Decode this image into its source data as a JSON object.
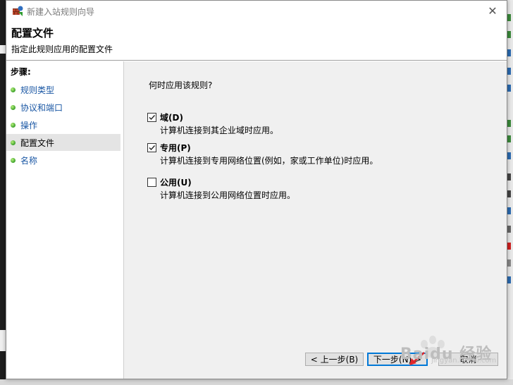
{
  "window": {
    "title": "新建入站规则向导",
    "close_glyph": "✕"
  },
  "header": {
    "title": "配置文件",
    "subtitle": "指定此规则应用的配置文件"
  },
  "steps": {
    "title": "步骤:",
    "items": [
      {
        "label": "规则类型"
      },
      {
        "label": "协议和端口"
      },
      {
        "label": "操作"
      },
      {
        "label": "配置文件",
        "active": true
      },
      {
        "label": "名称"
      }
    ]
  },
  "main": {
    "question": "何时应用该规则?",
    "options": [
      {
        "label": "域(D)",
        "description": "计算机连接到其企业域时应用。",
        "checked": true
      },
      {
        "label": "专用(P)",
        "description": "计算机连接到专用网络位置(例如，家或工作单位)时应用。",
        "checked": true
      },
      {
        "label": "公用(U)",
        "description": "计算机连接到公用网络位置时应用。",
        "checked": false
      }
    ]
  },
  "buttons": {
    "back": "< 上一步(B)",
    "next": "下一步(N) >",
    "cancel": "取消"
  },
  "watermark": {
    "text": "Baidu 经验",
    "sub": "jingyan.baidu.com"
  },
  "colors": {
    "link": "#1a57a4",
    "accent": "#0078d7",
    "arrow": "#e0262b"
  }
}
